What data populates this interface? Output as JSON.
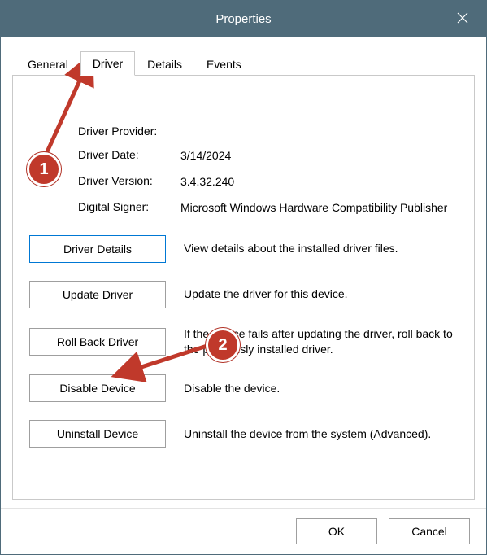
{
  "window": {
    "title": "Properties"
  },
  "tabs": {
    "general": "General",
    "driver": "Driver",
    "details": "Details",
    "events": "Events"
  },
  "info": {
    "provider_label": "Driver Provider:",
    "provider_value": "",
    "date_label": "Driver Date:",
    "date_value": "3/14/2024",
    "version_label": "Driver Version:",
    "version_value": "3.4.32.240",
    "signer_label": "Digital Signer:",
    "signer_value": "Microsoft Windows Hardware Compatibility Publisher"
  },
  "actions": {
    "details_btn": "Driver Details",
    "details_desc": "View details about the installed driver files.",
    "update_btn": "Update Driver",
    "update_desc": "Update the driver for this device.",
    "rollback_btn": "Roll Back Driver",
    "rollback_desc": "If the device fails after updating the driver, roll back to the previously installed driver.",
    "disable_btn": "Disable Device",
    "disable_desc": "Disable the device.",
    "uninstall_btn": "Uninstall Device",
    "uninstall_desc": "Uninstall the device from the system (Advanced)."
  },
  "footer": {
    "ok": "OK",
    "cancel": "Cancel"
  },
  "annotations": {
    "step1": "1",
    "step2": "2"
  }
}
